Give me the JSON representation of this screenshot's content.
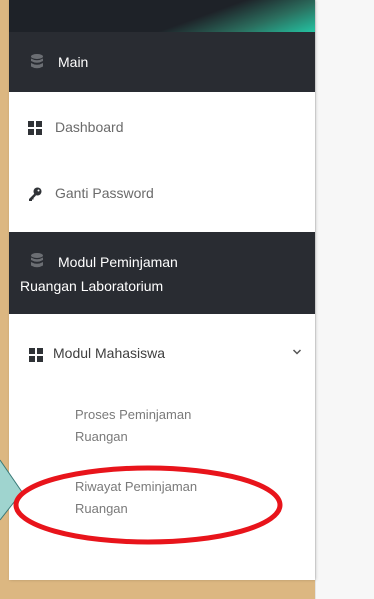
{
  "sidebar": {
    "sections": [
      {
        "title": "Main"
      },
      {
        "title_line1": "Modul Peminjaman",
        "title_line2": "Ruangan Laboratorium"
      }
    ],
    "items": [
      {
        "label": "Dashboard",
        "icon": "grid-icon"
      },
      {
        "label": "Ganti Password",
        "icon": "key-icon"
      }
    ],
    "module": {
      "label": "Modul Mahasiswa",
      "icon": "grid-icon",
      "expanded": true,
      "subitems": [
        {
          "line1": "Proses Peminjaman",
          "line2": "Ruangan"
        },
        {
          "line1": "Riwayat Peminjaman",
          "line2": "Ruangan"
        }
      ]
    }
  },
  "colors": {
    "background": "#dcb781",
    "section_header": "#292c32",
    "accent_teal": "#24c4a3",
    "annotation_red": "#e8141b",
    "annotation_pointer": "#9fd4cf"
  }
}
